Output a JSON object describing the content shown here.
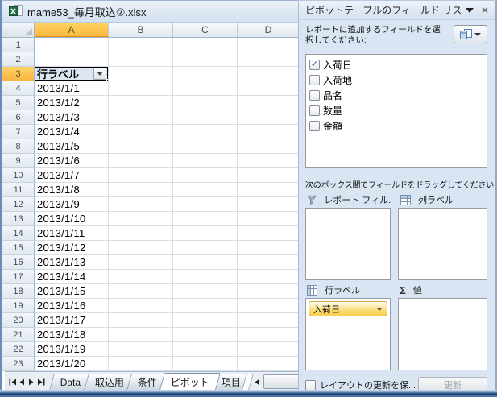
{
  "window": {
    "title": "mame53_毎月取込②.xlsx"
  },
  "grid": {
    "columns": [
      "A",
      "B",
      "C",
      "D"
    ],
    "selected_column": "A",
    "row_count": 23,
    "selected_row": 3,
    "filter_header": {
      "row": 3,
      "col": "A",
      "label": "行ラベル"
    },
    "date_start_row": 4,
    "dates": [
      "2013/1/1",
      "2013/1/2",
      "2013/1/3",
      "2013/1/4",
      "2013/1/5",
      "2013/1/6",
      "2013/1/7",
      "2013/1/8",
      "2013/1/9",
      "2013/1/10",
      "2013/1/11",
      "2013/1/12",
      "2013/1/13",
      "2013/1/14",
      "2013/1/15",
      "2013/1/16",
      "2013/1/17",
      "2013/1/18",
      "2013/1/19",
      "2013/1/20"
    ]
  },
  "sheet_tabs": {
    "tabs": [
      {
        "label": "Data",
        "active": false
      },
      {
        "label": "取込用",
        "active": false
      },
      {
        "label": "条件",
        "active": false
      },
      {
        "label": "ピボット",
        "active": true
      },
      {
        "label": "項目",
        "active": false,
        "truncated": true
      }
    ]
  },
  "panel": {
    "title": "ピボットテーブルのフィールド リス",
    "instruction": "レポートに追加するフィールドを選択してください:",
    "fields": [
      {
        "label": "入荷日",
        "checked": true
      },
      {
        "label": "入荷地",
        "checked": false
      },
      {
        "label": "品名",
        "checked": false
      },
      {
        "label": "数量",
        "checked": false
      },
      {
        "label": "金額",
        "checked": false
      }
    ],
    "drag_instruction": "次のボックス間でフィールドをドラッグしてください:",
    "zones": {
      "report_filter": {
        "label": "レポート フィル...",
        "items": []
      },
      "column_labels": {
        "label": "列ラベル",
        "items": []
      },
      "row_labels": {
        "label": "行ラベル",
        "items": [
          "入荷日"
        ]
      },
      "values": {
        "label": "値",
        "icon": "Σ",
        "items": []
      }
    },
    "defer_label": "レイアウトの更新を保...",
    "update_label": "更新",
    "accent_colors": {
      "selected_header": "#fcc04d",
      "field_pill": "#fbda6d",
      "panel_bg": "#d9e5f2"
    }
  }
}
